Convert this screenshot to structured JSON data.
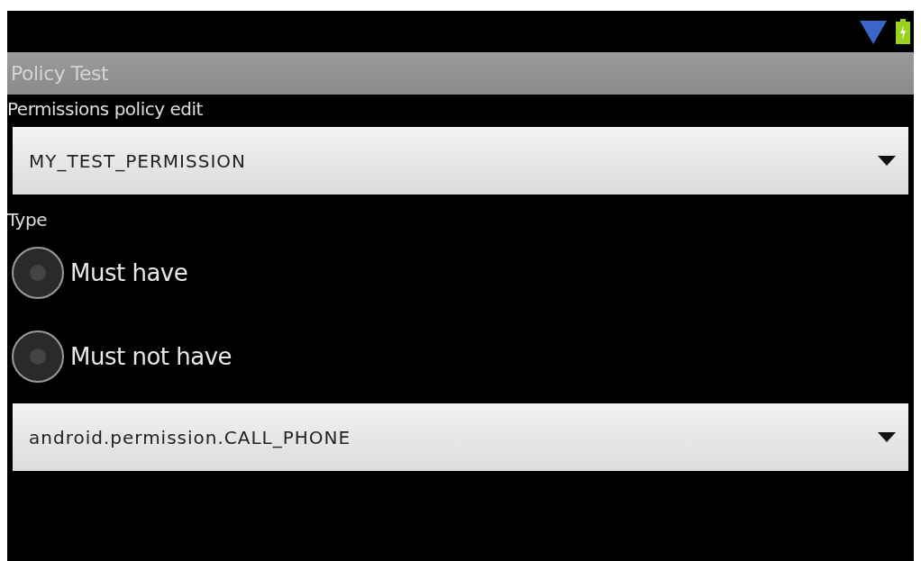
{
  "title_bar": {
    "title": "Policy Test"
  },
  "form": {
    "heading": "Permissions policy edit",
    "permission_spinner": {
      "value": "MY_TEST_PERMISSION"
    },
    "type_label": "Type",
    "type_options": [
      {
        "label": "Must have",
        "selected": false
      },
      {
        "label": "Must not have",
        "selected": false
      }
    ],
    "target_spinner": {
      "value": "android.permission.CALL_PHONE"
    }
  }
}
